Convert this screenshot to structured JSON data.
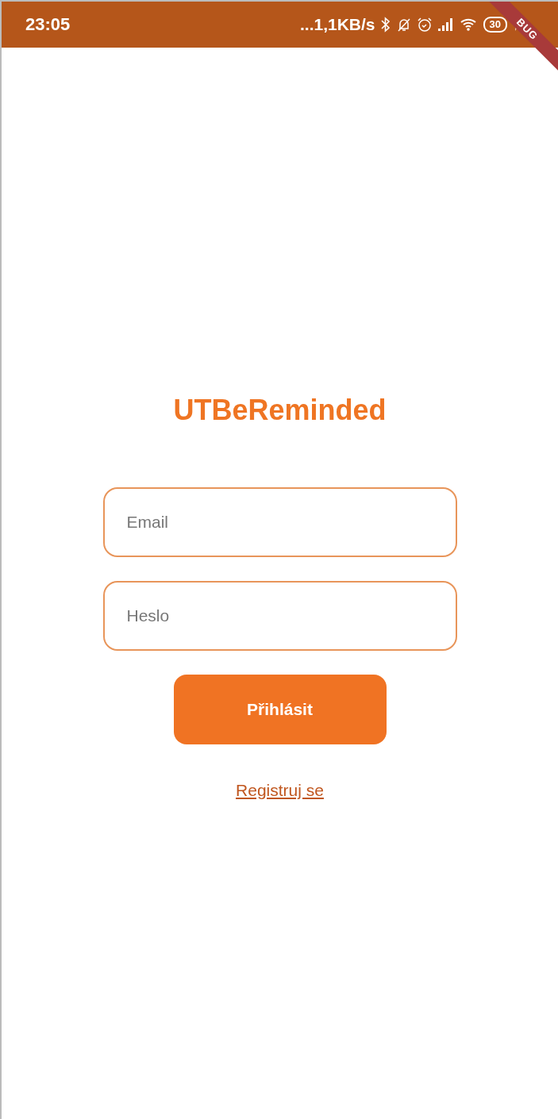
{
  "status_bar": {
    "time": "23:05",
    "network_speed": "...1,1KB/s",
    "battery": "30"
  },
  "debug_banner": {
    "label": "BUG"
  },
  "app_title": "UTBeReminded",
  "fields": [
    {
      "placeholder": "Email"
    },
    {
      "placeholder": "Heslo"
    }
  ],
  "login_button": "Přihlásit",
  "register_link": "Registruj se"
}
